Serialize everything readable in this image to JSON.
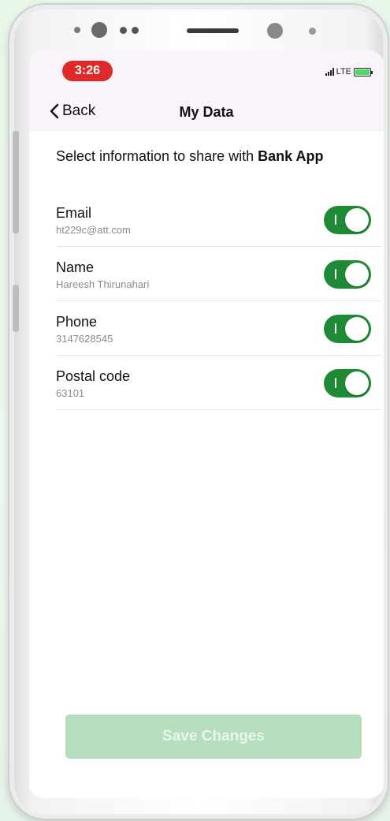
{
  "status_bar": {
    "time": "3:26",
    "network": "LTE"
  },
  "nav": {
    "back_label": "Back",
    "title": "My Data"
  },
  "prompt": {
    "text": "Select information to share with ",
    "app_name": "Bank App"
  },
  "fields": [
    {
      "label": "Email",
      "value": "ht229c@att.com",
      "enabled": true
    },
    {
      "label": "Name",
      "value": "Hareesh Thirunahari",
      "enabled": true
    },
    {
      "label": "Phone",
      "value": "3147628545",
      "enabled": true
    },
    {
      "label": "Postal code",
      "value": "63101",
      "enabled": true
    }
  ],
  "save_button": {
    "label": "Save Changes",
    "disabled": true
  },
  "colors": {
    "toggle_on": "#1f8a35",
    "save_disabled": "#b6ddbd",
    "time_pill": "#e02a2a"
  }
}
